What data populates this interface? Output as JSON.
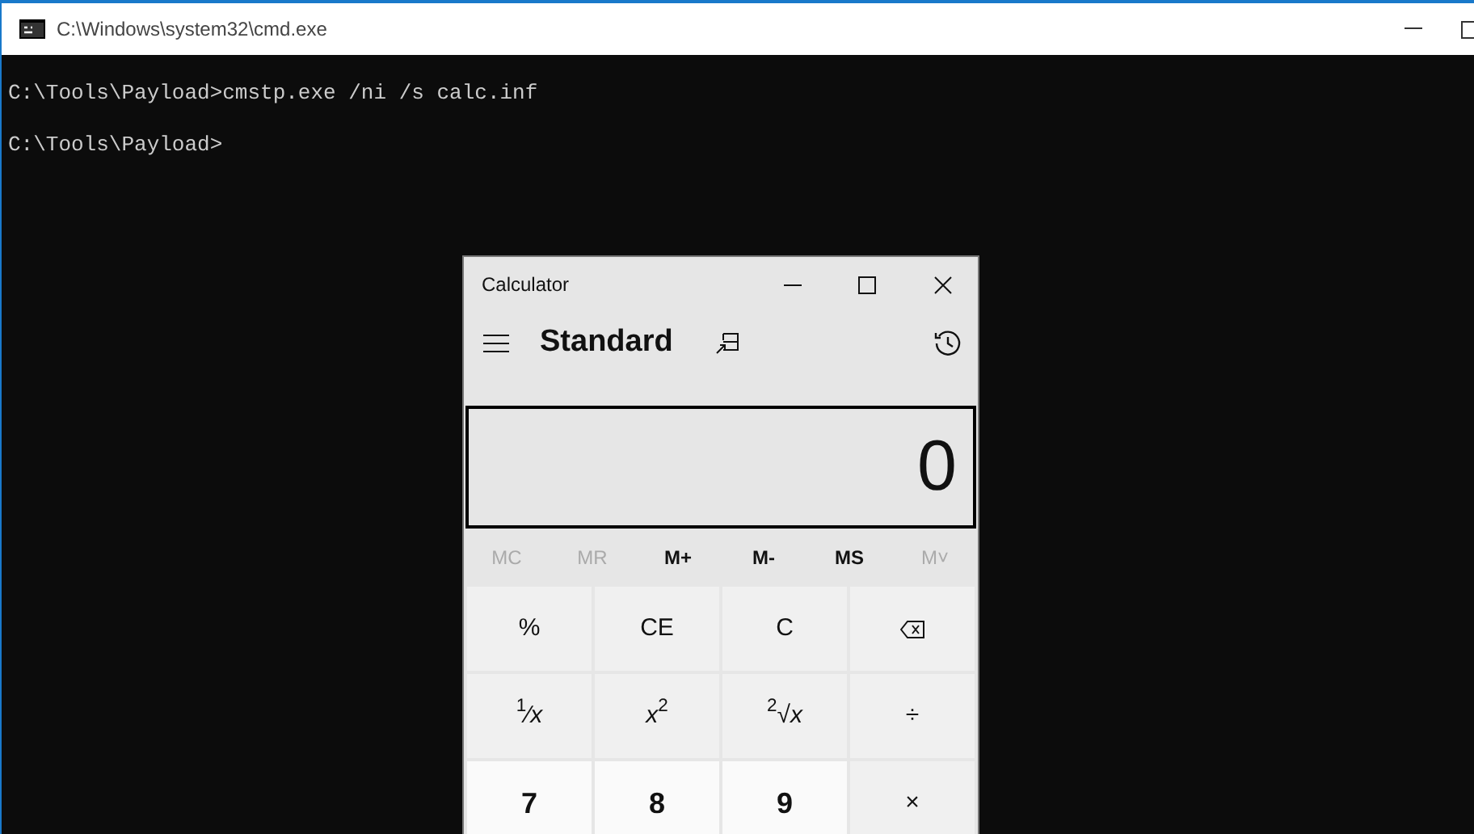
{
  "console_window": {
    "title": "C:\\Windows\\system32\\cmd.exe"
  },
  "console_lines": [
    "C:\\Tools\\Payload>cmstp.exe /ni /s calc.inf",
    "C:\\Tools\\Payload>"
  ],
  "calculator": {
    "title": "Calculator",
    "mode": "Standard",
    "display": "0",
    "memory": [
      {
        "label": "MC",
        "disabled": true
      },
      {
        "label": "MR",
        "disabled": true
      },
      {
        "label": "M+",
        "disabled": false
      },
      {
        "label": "M-",
        "disabled": false
      },
      {
        "label": "MS",
        "disabled": false
      },
      {
        "label": "M˅",
        "disabled": true
      }
    ],
    "keys": [
      {
        "kind": "op",
        "label": "%"
      },
      {
        "kind": "op",
        "label": "CE"
      },
      {
        "kind": "op",
        "label": "C"
      },
      {
        "kind": "backspace"
      },
      {
        "kind": "op",
        "label": "$^{1}$⁄*x*"
      },
      {
        "kind": "op",
        "label": "*x*$^{2}$"
      },
      {
        "kind": "op",
        "label": "$^{2}$√*x*"
      },
      {
        "kind": "op",
        "label": "÷"
      },
      {
        "kind": "digit",
        "label": "7"
      },
      {
        "kind": "digit",
        "label": "8"
      },
      {
        "kind": "digit",
        "label": "9"
      },
      {
        "kind": "op",
        "label": "×"
      }
    ]
  }
}
